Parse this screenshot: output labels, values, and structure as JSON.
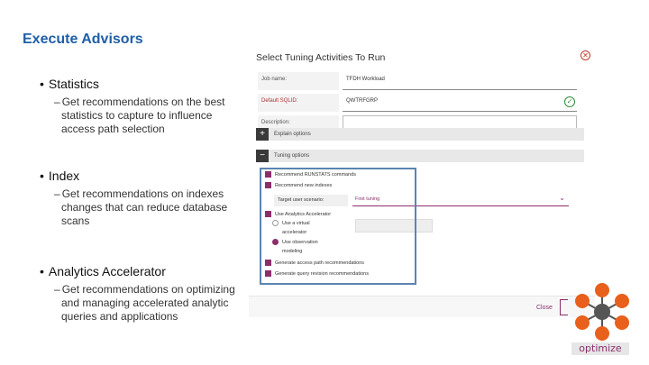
{
  "slide": {
    "title": "Execute Advisors",
    "bullets": [
      {
        "heading": "Statistics",
        "sub": "Get recommendations on the best statistics to capture to influence access path selection"
      },
      {
        "heading": "Index",
        "sub": "Get recommendations on indexes changes that can reduce database scans"
      },
      {
        "heading": "Analytics Accelerator",
        "sub": "Get recommendations on optimizing and managing accelerated analytic queries and applications"
      }
    ]
  },
  "dialog": {
    "title": "Select Tuning Activities To Run",
    "fields": {
      "job_name": {
        "label": "Job name:",
        "value": "TFDH Workload"
      },
      "default_sqlid": {
        "label": "Default SQLID:",
        "value": "QWTRFGRP"
      },
      "description": {
        "label": "Description:",
        "value": ""
      }
    },
    "sections": {
      "explain": "Explain options",
      "tuning": "Tuning options"
    },
    "options": {
      "recommend_runstats": "Recommend RUNSTATS commands",
      "recommend_indexes": "Recommend new indexes",
      "target_label": "Target user scenario:",
      "target_value": "First tuning",
      "use_accelerator": "Use Analytics Accelerator",
      "use_virtual": "Use a virtual",
      "accelerator": "accelerator",
      "use_observation": "Use observation",
      "modeling": "modeling",
      "generate_access_path": "Generate access path recommendations",
      "generate_query_revision": "Generate query revision recommendations"
    },
    "footer": {
      "close": "Close"
    }
  },
  "logo": {
    "text": "optimize",
    "accent": "#8b2f6b",
    "orange": "#e8601c"
  }
}
